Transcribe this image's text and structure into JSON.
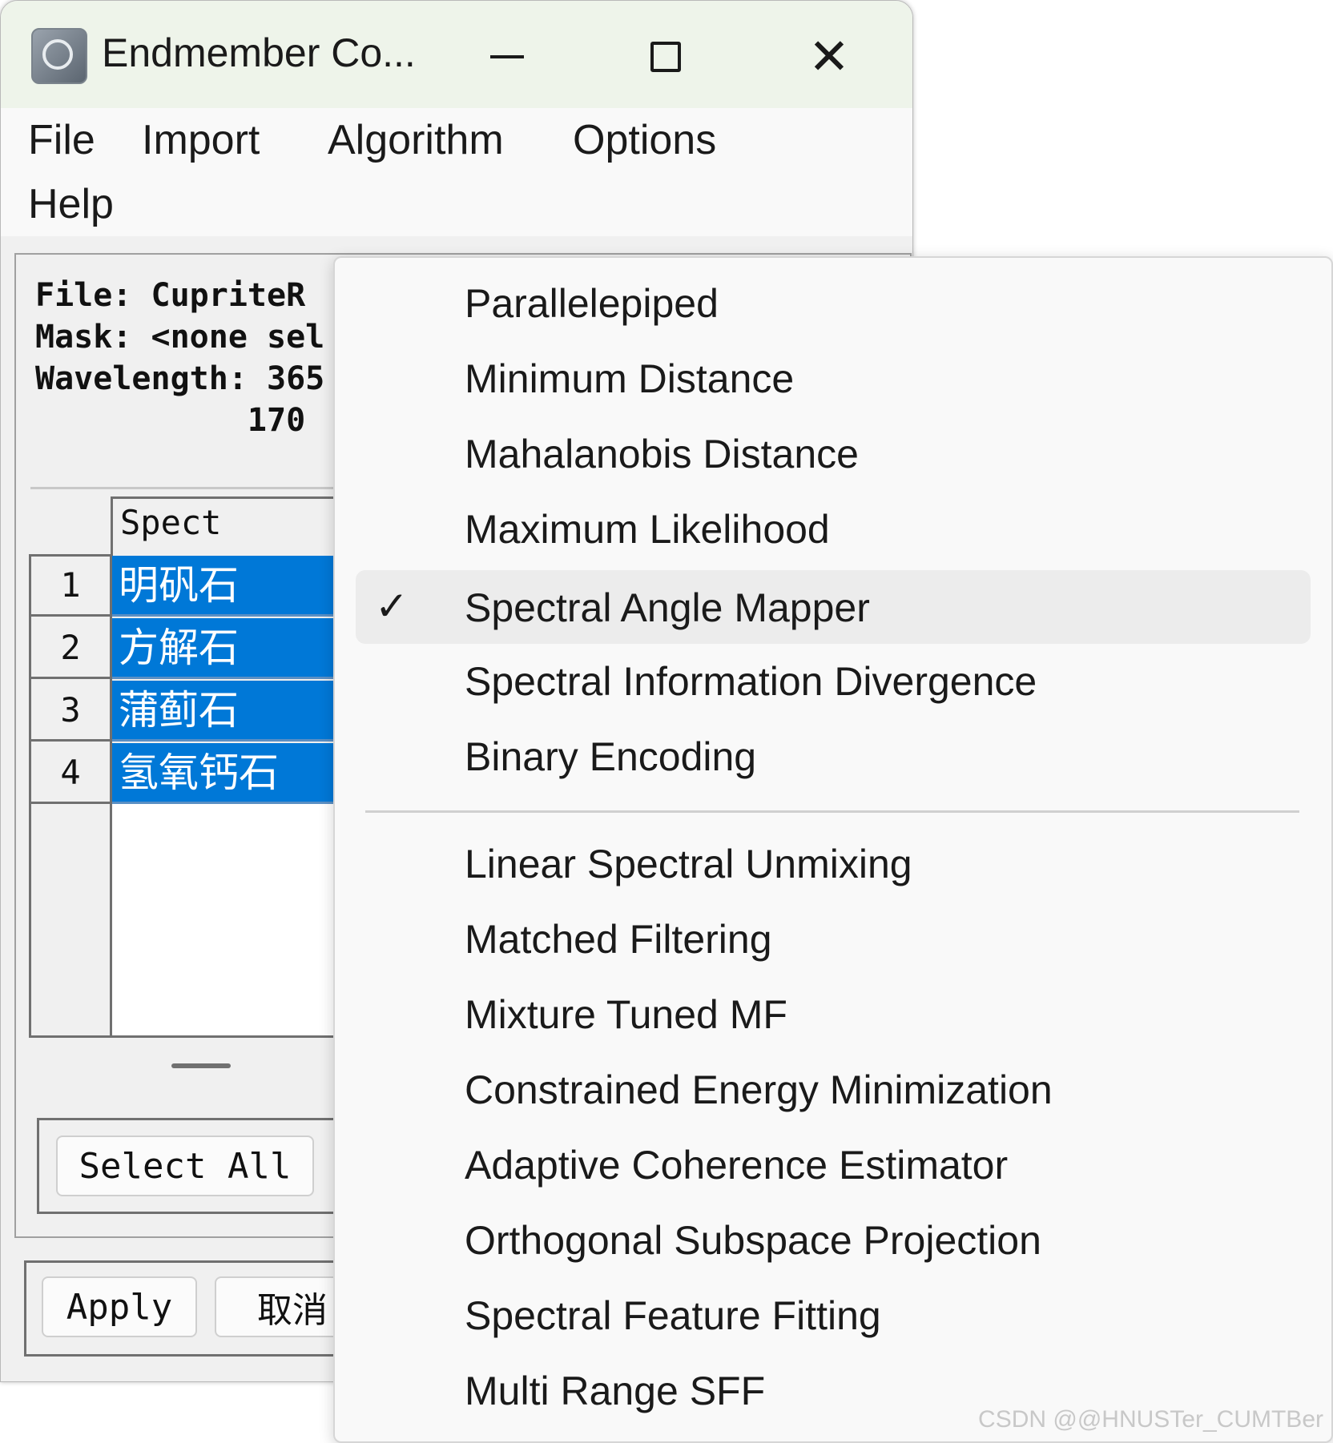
{
  "window": {
    "title": "Endmember Co...",
    "minimize_icon": "minimize-icon",
    "maximize_icon": "maximize-icon",
    "close_icon": "close-icon"
  },
  "menubar": {
    "items": [
      "File",
      "Import",
      "Algorithm",
      "Options",
      "Help"
    ]
  },
  "info": {
    "file": "File: CupriteR",
    "mask": "Mask: <none sel",
    "wavelength": "Wavelength: 365",
    "wavelength2": "           170"
  },
  "table": {
    "column_header": "Spect",
    "rows": [
      {
        "num": "1",
        "name": "明矾石"
      },
      {
        "num": "2",
        "name": "方解石"
      },
      {
        "num": "3",
        "name": "蒲蓟石"
      },
      {
        "num": "4",
        "name": "氢氧钙石"
      }
    ]
  },
  "buttons": {
    "select_all": "Select All",
    "apply": "Apply",
    "cancel": "取消"
  },
  "algorithm_menu": {
    "group1": [
      {
        "label": "Parallelepiped",
        "checked": false
      },
      {
        "label": "Minimum Distance",
        "checked": false
      },
      {
        "label": "Mahalanobis Distance",
        "checked": false
      },
      {
        "label": "Maximum Likelihood",
        "checked": false
      },
      {
        "label": "Spectral Angle Mapper",
        "checked": true
      },
      {
        "label": "Spectral Information Divergence",
        "checked": false
      },
      {
        "label": "Binary Encoding",
        "checked": false
      }
    ],
    "group2": [
      {
        "label": "Linear Spectral Unmixing"
      },
      {
        "label": "Matched Filtering"
      },
      {
        "label": "Mixture Tuned MF"
      },
      {
        "label": "Constrained Energy Minimization"
      },
      {
        "label": "Adaptive Coherence Estimator"
      },
      {
        "label": "Orthogonal Subspace Projection"
      },
      {
        "label": "Spectral Feature Fitting"
      },
      {
        "label": "Multi Range SFF"
      }
    ],
    "check_mark": "✓"
  },
  "watermark": "CSDN @@HNUSTer_CUMTBer",
  "colors": {
    "selection": "#0078d7",
    "titlebar": "#eef4ea",
    "menu_bg": "#f9f9f9"
  }
}
